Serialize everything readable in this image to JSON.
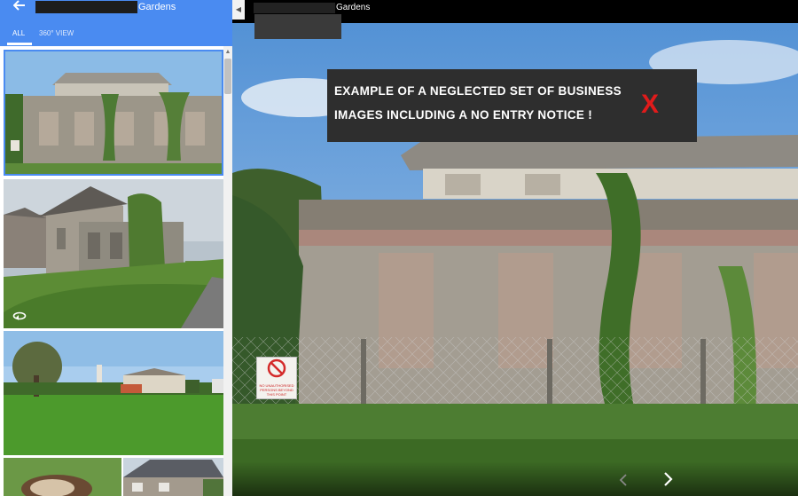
{
  "header": {
    "title_suffix": "Gardens",
    "back_icon": "arrow-left-icon"
  },
  "tabs": [
    {
      "label": "ALL",
      "active": true
    },
    {
      "label": "360° VIEW",
      "active": false
    }
  ],
  "viewer": {
    "title_suffix": "Gardens",
    "annotation": {
      "line1": "EXAMPLE OF A NEGLECTED SET OF BUSINESS",
      "line2": "IMAGES INCLUDING A NO ENTRY NOTICE !",
      "mark": "X"
    },
    "sign_text": "NO UNAUTHORISED PERSONS BEYOND THIS POINT"
  },
  "icons": {
    "collapse": "chevron-left-icon",
    "prev": "chevron-left-icon",
    "next": "chevron-right-icon",
    "photosphere": "360-rotate-icon"
  },
  "colors": {
    "accent": "#4a8bf1",
    "annotation_bg": "#2e2e2e",
    "annotation_mark": "#e01b1b"
  }
}
